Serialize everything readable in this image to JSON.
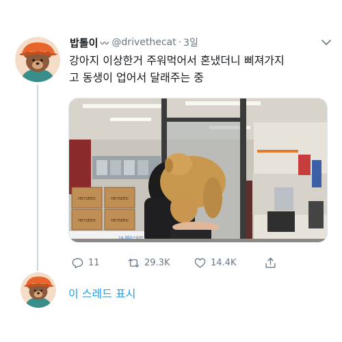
{
  "tweet": {
    "display_name": "밥톨이",
    "name_emoji": "〰",
    "handle": "@drivethecat",
    "separator": "·",
    "time": "3일",
    "text": "강아지 이상한거 주워먹어서 혼냈더니 삐져가지\n고 동생이 업어서 달래주는 중",
    "avatar_icon": "bear-with-hat-avatar",
    "more_icon": "chevron-down-icon"
  },
  "media": {
    "box_label_1": "HEYSEED",
    "box_label_2": "HEYSEED",
    "box_label_3": "HEYSEED",
    "box_label_4": "HEYSEED",
    "store_sign": "24 에이스마트 LE"
  },
  "actions": {
    "reply_count": "11",
    "retweet_count": "29.3K",
    "like_count": "14.4K",
    "reply_icon": "reply-icon",
    "retweet_icon": "retweet-icon",
    "like_icon": "heart-icon",
    "share_icon": "share-icon"
  },
  "thread": {
    "show_thread_label": "이 스레드 표시"
  },
  "colors": {
    "link": "#1da1f2",
    "muted": "#657786",
    "text": "#14171a",
    "thread_line": "#ccd6dd"
  }
}
